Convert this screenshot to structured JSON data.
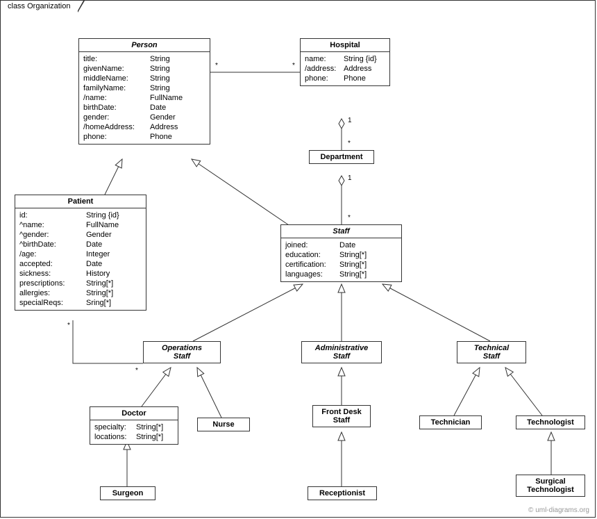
{
  "frame": {
    "title": "class Organization"
  },
  "watermark": "© uml-diagrams.org",
  "classes": {
    "person": {
      "name": "Person",
      "attrs": [
        {
          "n": "title:",
          "t": "String"
        },
        {
          "n": "givenName:",
          "t": "String"
        },
        {
          "n": "middleName:",
          "t": "String"
        },
        {
          "n": "familyName:",
          "t": "String"
        },
        {
          "n": "/name:",
          "t": "FullName"
        },
        {
          "n": "birthDate:",
          "t": "Date"
        },
        {
          "n": "gender:",
          "t": "Gender"
        },
        {
          "n": "/homeAddress:",
          "t": "Address"
        },
        {
          "n": "phone:",
          "t": "Phone"
        }
      ]
    },
    "hospital": {
      "name": "Hospital",
      "attrs": [
        {
          "n": "name:",
          "t": "String {id}"
        },
        {
          "n": "/address:",
          "t": "Address"
        },
        {
          "n": "phone:",
          "t": "Phone"
        }
      ]
    },
    "department": {
      "name": "Department"
    },
    "patient": {
      "name": "Patient",
      "attrs": [
        {
          "n": "id:",
          "t": "String {id}"
        },
        {
          "n": "^name:",
          "t": "FullName"
        },
        {
          "n": "^gender:",
          "t": "Gender"
        },
        {
          "n": "^birthDate:",
          "t": "Date"
        },
        {
          "n": "/age:",
          "t": "Integer"
        },
        {
          "n": "accepted:",
          "t": "Date"
        },
        {
          "n": "sickness:",
          "t": "History"
        },
        {
          "n": "prescriptions:",
          "t": "String[*]"
        },
        {
          "n": "allergies:",
          "t": "String[*]"
        },
        {
          "n": "specialReqs:",
          "t": "Sring[*]"
        }
      ]
    },
    "staff": {
      "name": "Staff",
      "attrs": [
        {
          "n": "joined:",
          "t": "Date"
        },
        {
          "n": "education:",
          "t": "String[*]"
        },
        {
          "n": "certification:",
          "t": "String[*]"
        },
        {
          "n": "languages:",
          "t": "String[*]"
        }
      ]
    },
    "opsStaff": {
      "name": "Operations",
      "name2": "Staff"
    },
    "adminStaff": {
      "name": "Administrative",
      "name2": "Staff"
    },
    "techStaff": {
      "name": "Technical",
      "name2": "Staff"
    },
    "doctor": {
      "name": "Doctor",
      "attrs": [
        {
          "n": "specialty:",
          "t": "String[*]"
        },
        {
          "n": "locations:",
          "t": "String[*]"
        }
      ]
    },
    "nurse": {
      "name": "Nurse"
    },
    "frontDesk": {
      "name": "Front Desk",
      "name2": "Staff"
    },
    "technician": {
      "name": "Technician"
    },
    "technologist": {
      "name": "Technologist"
    },
    "surgeon": {
      "name": "Surgeon"
    },
    "receptionist": {
      "name": "Receptionist"
    },
    "surgicalTech": {
      "name": "Surgical",
      "name2": "Technologist"
    }
  },
  "mults": {
    "person_hospital_left": "*",
    "person_hospital_right": "*",
    "hospital_dept_top": "1",
    "hospital_dept_bottom": "*",
    "dept_staff_top": "1",
    "dept_staff_bottom": "*",
    "patient_ops_left": "*",
    "patient_ops_right": "*"
  }
}
